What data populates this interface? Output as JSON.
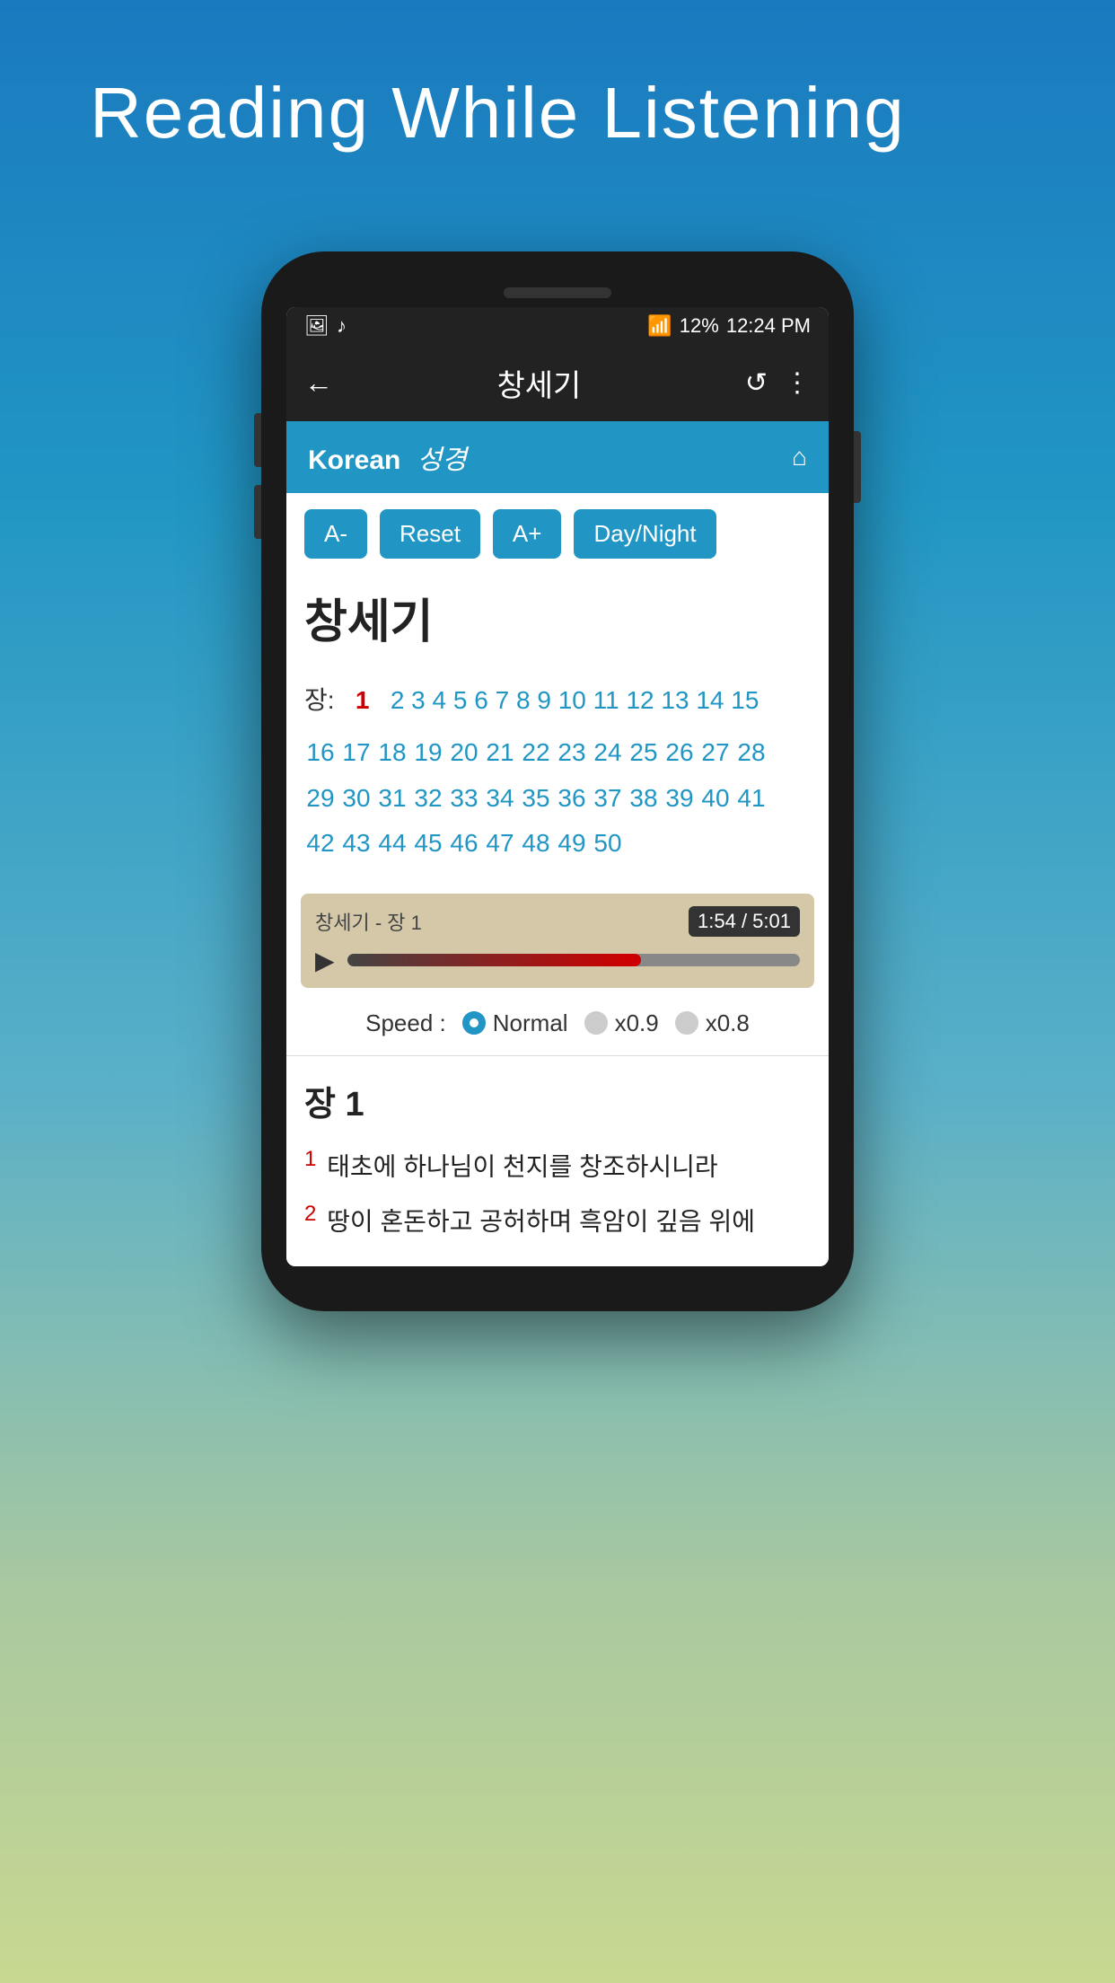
{
  "header": {
    "title": "Reading While Listening"
  },
  "statusBar": {
    "wifi": "wifi",
    "signal": "signal",
    "battery": "12%",
    "time": "12:24 PM"
  },
  "appBar": {
    "back": "←",
    "title": "창세기",
    "refresh": "↺",
    "menu": "⋮"
  },
  "koreanHeader": {
    "main": "Korean",
    "sub": "성경",
    "home": "⌂"
  },
  "controls": {
    "decrease": "A-",
    "reset": "Reset",
    "increase": "A+",
    "daynight": "Day/Night"
  },
  "bookTitle": "창세기",
  "chaptersLabel": "장:",
  "chapters": [
    "1",
    "2",
    "3",
    "4",
    "5",
    "6",
    "7",
    "8",
    "9",
    "10",
    "11",
    "12",
    "13",
    "14",
    "15",
    "16",
    "17",
    "18",
    "19",
    "20",
    "21",
    "22",
    "23",
    "24",
    "25",
    "26",
    "27",
    "28",
    "29",
    "30",
    "31",
    "32",
    "33",
    "34",
    "35",
    "36",
    "37",
    "38",
    "39",
    "40",
    "41",
    "42",
    "43",
    "44",
    "45",
    "46",
    "47",
    "48",
    "49",
    "50"
  ],
  "activeChapter": "1",
  "audioPlayer": {
    "title": "창세기 - 장 1",
    "currentTime": "1:54",
    "totalTime": "5:01",
    "timeDisplay": "1:54 / 5:01",
    "progress": 65
  },
  "speedSelector": {
    "label": "Speed :",
    "options": [
      {
        "id": "normal",
        "label": "Normal",
        "selected": true
      },
      {
        "id": "x09",
        "label": "x0.9",
        "selected": false
      },
      {
        "id": "x08",
        "label": "x0.8",
        "selected": false
      }
    ]
  },
  "chapterContent": {
    "heading": "장 1",
    "verses": [
      {
        "num": "1",
        "text": "태초에 하나님이 천지를 창조하시니라"
      },
      {
        "num": "2",
        "text": "땅이 혼돈하고 공허하며 흑암이 깊음 위에"
      }
    ]
  }
}
